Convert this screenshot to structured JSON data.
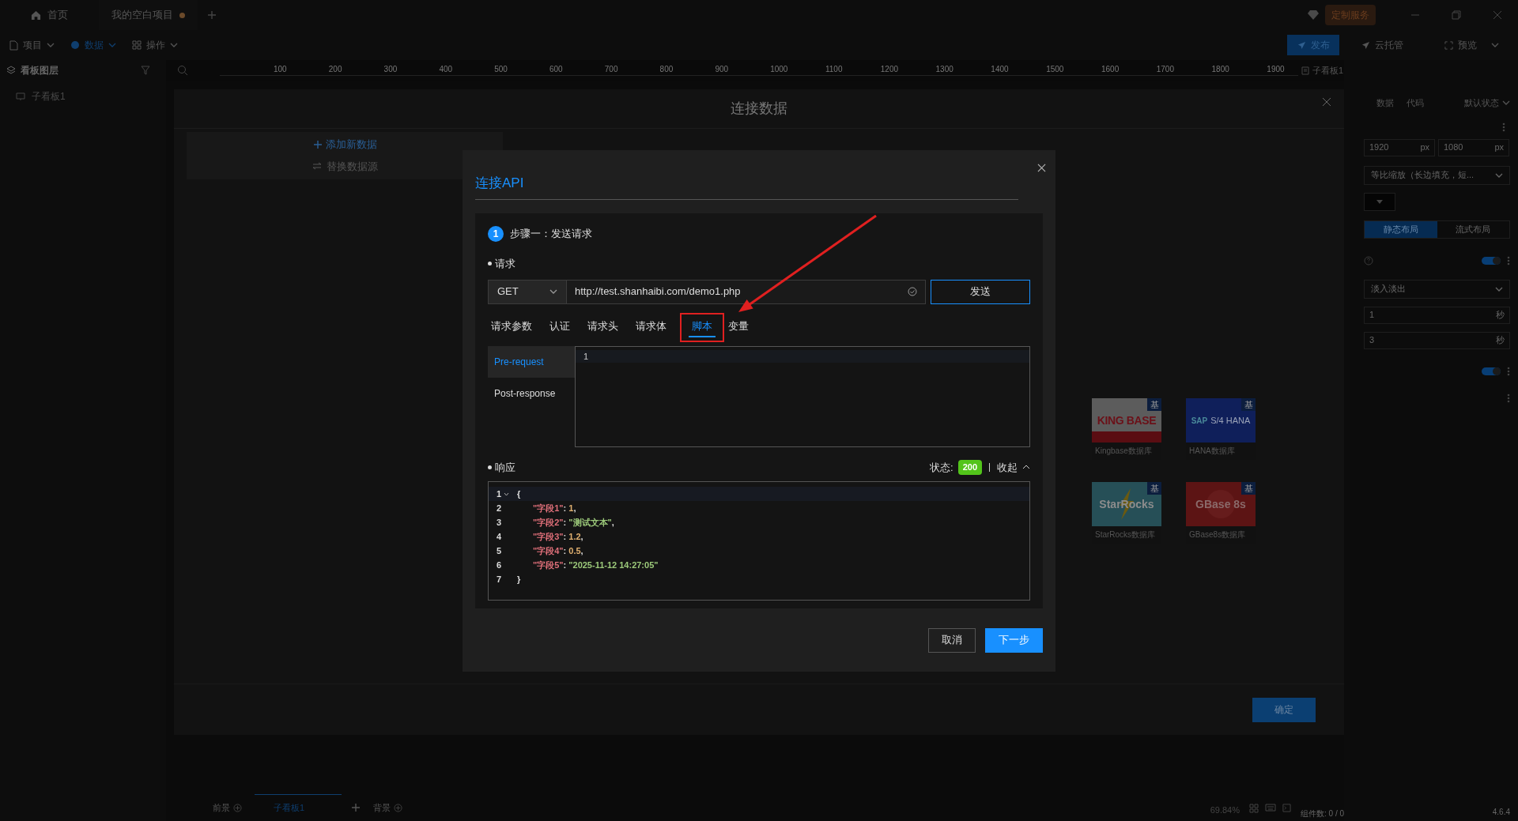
{
  "app_tabs": [
    {
      "kind": "home",
      "label": "首页",
      "unsaved": false
    },
    {
      "kind": "project",
      "label": "我的空白项目",
      "unsaved": true
    }
  ],
  "service_badge": "定制服务",
  "menu": [
    {
      "kind": "doc",
      "label": "项目",
      "selected": false
    },
    {
      "kind": "db",
      "label": "数据",
      "selected": true
    },
    {
      "kind": "grid",
      "label": "操作",
      "selected": false
    }
  ],
  "actions": {
    "publish": "发布",
    "cloud": "云托管",
    "preview": "预览"
  },
  "layers_panel": {
    "title": "看板图层",
    "items": [
      {
        "label": "子看板1"
      }
    ]
  },
  "ruler": {
    "ticks": [
      "100",
      "200",
      "300",
      "400",
      "500",
      "600",
      "700",
      "800",
      "900",
      "1000",
      "1100",
      "1200",
      "1300",
      "1400",
      "1500",
      "1600",
      "1700",
      "1800",
      "1900"
    ],
    "board_label": "子看板1"
  },
  "properties": {
    "tabs": [
      "数据",
      "代码"
    ],
    "state_select": "默认状态",
    "width": {
      "value": "1920",
      "unit": "px"
    },
    "height": {
      "value": "1080",
      "unit": "px"
    },
    "scale_mode": "等比缩放（长边填充，短...",
    "layouts": [
      {
        "label": "静态布局",
        "selected": true
      },
      {
        "label": "流式布局",
        "selected": false
      }
    ],
    "rows": [
      {
        "kind": "toggle",
        "on": true,
        "help": true
      },
      {
        "kind": "select",
        "value": "淡入淡出"
      },
      {
        "kind": "input",
        "value": "1",
        "unit": "秒"
      },
      {
        "kind": "input",
        "value": "3",
        "unit": "秒"
      },
      {
        "kind": "toggle",
        "on": true,
        "help": false
      },
      {
        "kind": "more"
      }
    ]
  },
  "data_dialog": {
    "title": "连接数据",
    "add": "添加新数据",
    "replace": "替换数据源",
    "confirm": "确定",
    "sources": [
      {
        "kind": "kingbase",
        "logo": "KING BASE",
        "badge": "基",
        "name": "Kingbase数据库"
      },
      {
        "kind": "sap",
        "logo": "S/4 HANA",
        "logo_mark": "SAP",
        "badge": "基",
        "name": "HANA数据库"
      },
      {
        "kind": "starrocks",
        "logo": "StarRocks",
        "badge": "基",
        "name": "StarRocks数据库"
      },
      {
        "kind": "gbase",
        "logo": "GBase 8s",
        "badge": "基",
        "name": "GBase8s数据库"
      }
    ]
  },
  "api_dialog": {
    "title": "连接API",
    "step": {
      "number": "1",
      "label": "步骤一：发送请求"
    },
    "request_label": "请求",
    "method": "GET",
    "url": "http://test.shanhaibi.com/demo1.php",
    "send": "发送",
    "tabs": [
      {
        "label": "请求参数",
        "selected": false
      },
      {
        "label": "认证",
        "selected": false
      },
      {
        "label": "请求头",
        "selected": false
      },
      {
        "label": "请求体",
        "selected": false
      },
      {
        "label": "脚本",
        "selected": true
      },
      {
        "label": "变量",
        "selected": false
      }
    ],
    "script_sides": [
      {
        "label": "Pre-request",
        "selected": true
      },
      {
        "label": "Post-response",
        "selected": false
      }
    ],
    "editor_lines": [
      "1"
    ],
    "response_label": "响应",
    "status_label": "状态:",
    "status_code": "200",
    "collapse": "收起",
    "response_lines": [
      {
        "no": "1",
        "foldable": true,
        "tokens": [
          {
            "kind": "punct",
            "text": "{"
          }
        ]
      },
      {
        "no": "2",
        "foldable": false,
        "tokens": [
          {
            "kind": "key",
            "text": "\"字段1\""
          },
          {
            "kind": "punct",
            "text": ": "
          },
          {
            "kind": "number",
            "text": "1"
          },
          {
            "kind": "punct",
            "text": ","
          }
        ]
      },
      {
        "no": "3",
        "foldable": false,
        "tokens": [
          {
            "kind": "key",
            "text": "\"字段2\""
          },
          {
            "kind": "punct",
            "text": ": "
          },
          {
            "kind": "string",
            "text": "\"测试文本\""
          },
          {
            "kind": "punct",
            "text": ","
          }
        ]
      },
      {
        "no": "4",
        "foldable": false,
        "tokens": [
          {
            "kind": "key",
            "text": "\"字段3\""
          },
          {
            "kind": "punct",
            "text": ": "
          },
          {
            "kind": "number",
            "text": "1.2"
          },
          {
            "kind": "punct",
            "text": ","
          }
        ]
      },
      {
        "no": "5",
        "foldable": false,
        "tokens": [
          {
            "kind": "key",
            "text": "\"字段4\""
          },
          {
            "kind": "punct",
            "text": ": "
          },
          {
            "kind": "number",
            "text": "0.5"
          },
          {
            "kind": "punct",
            "text": ","
          }
        ]
      },
      {
        "no": "6",
        "foldable": false,
        "tokens": [
          {
            "kind": "key",
            "text": "\"字段5\""
          },
          {
            "kind": "punct",
            "text": ": "
          },
          {
            "kind": "string",
            "text": "\"2025-11-12 14:27:05\""
          }
        ]
      },
      {
        "no": "7",
        "foldable": false,
        "tokens": [
          {
            "kind": "punct",
            "text": "}"
          }
        ]
      }
    ],
    "cancel": "取消",
    "next": "下一步"
  },
  "bottom_bar": {
    "tabs": [
      {
        "label": "前景",
        "selected": false
      },
      {
        "label": "子看板1",
        "selected": true
      },
      {
        "label": "背景",
        "selected": false
      }
    ],
    "zoom": "69.84%",
    "component_count": "组件数: 0 / 0",
    "version": "4.6.4"
  }
}
